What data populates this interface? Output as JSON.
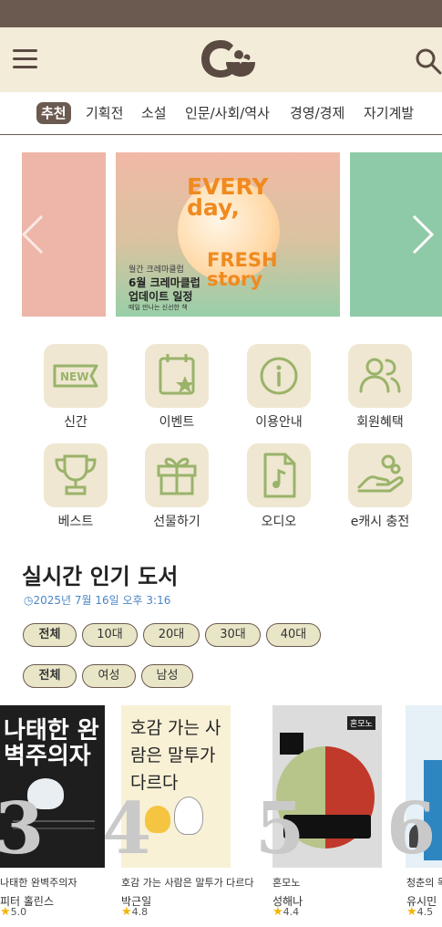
{
  "categories": [
    "추천",
    "기획전",
    "소설",
    "인문/사회/역사",
    "경영/경제",
    "자기계발"
  ],
  "banner": {
    "headline_top": "EVERY day,",
    "headline_bottom": "FRESH story",
    "small": "월간 크레마클럽",
    "line1": "6월 크레마클럽",
    "line2": "업데이트 일정",
    "line3": "매일 만나는 신선한 책"
  },
  "menu": [
    {
      "label": "신간",
      "icon": "new-badge-icon"
    },
    {
      "label": "이벤트",
      "icon": "calendar-star-icon"
    },
    {
      "label": "이용안내",
      "icon": "info-icon"
    },
    {
      "label": "회원혜택",
      "icon": "users-icon"
    },
    {
      "label": "베스트",
      "icon": "trophy-icon"
    },
    {
      "label": "선물하기",
      "icon": "gift-icon"
    },
    {
      "label": "오디오",
      "icon": "audio-file-icon"
    },
    {
      "label": "e캐시 충전",
      "icon": "hand-coin-icon"
    }
  ],
  "popular": {
    "title": "실시간 인기 도서",
    "timestamp": "2025년 7월 16일 오후 3:16",
    "age_filters": [
      "전체",
      "10대",
      "20대",
      "30대",
      "40대"
    ],
    "gender_filters": [
      "전체",
      "여성",
      "남성"
    ]
  },
  "books": [
    {
      "rank": "3",
      "title": "나태한 완벽주의자",
      "author": "피터 홀린스",
      "rating": "5.0",
      "cover_title": "나태한 완벽주의자"
    },
    {
      "rank": "4",
      "title": "호감 가는 사람은 말투가 다르다",
      "author": "박근일",
      "rating": "4.8",
      "cover_title": "호감 가는 사람은 말투가 다르다"
    },
    {
      "rank": "5",
      "title": "혼모노",
      "author": "성해나",
      "rating": "4.4",
      "cover_title": "혼모노"
    },
    {
      "rank": "6",
      "title": "청춘의 독서",
      "author": "유시민",
      "rating": "4.5",
      "cover_title": ""
    }
  ],
  "colors": {
    "brown": "#6b5a50",
    "cream": "#f3ecd9",
    "chip": "#e9e6c8",
    "icon_green": "#9ab36a",
    "link_blue": "#4a86c5"
  }
}
